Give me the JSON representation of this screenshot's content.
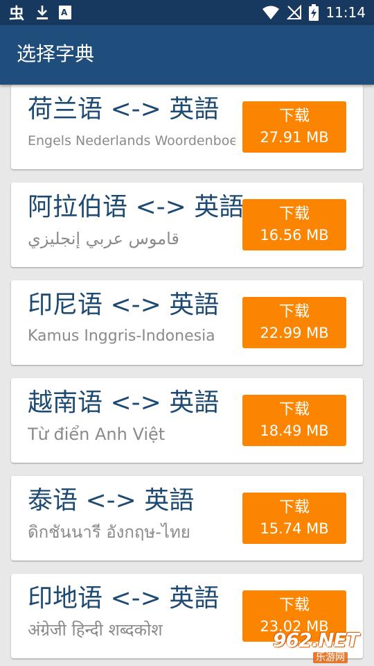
{
  "status_bar": {
    "time": "11:14",
    "left_icons": [
      "bug-icon",
      "download-icon",
      "font-icon"
    ],
    "right_icons": [
      "wifi-icon",
      "no-signal-icon",
      "battery-charging-icon"
    ]
  },
  "app_bar": {
    "title": "选择字典"
  },
  "colors": {
    "status_bar": "#17395f",
    "app_bar": "#1f4e7c",
    "title_text": "#1c4a73",
    "subtitle_text": "#8a8a8a",
    "button": "#fb8500",
    "background": "#e8e8e8"
  },
  "dictionaries": [
    {
      "title": "荷兰语 <-> 英語",
      "subtitle": "Engels Nederlands Woordenboek",
      "button_label": "下载",
      "size": "27.91 MB"
    },
    {
      "title": "阿拉伯语 <-> 英語",
      "subtitle": "قاموس عربي إنجليزي",
      "button_label": "下载",
      "size": "16.56 MB"
    },
    {
      "title": "印尼语 <-> 英語",
      "subtitle": "Kamus Inggris-Indonesia",
      "button_label": "下载",
      "size": "22.99 MB"
    },
    {
      "title": "越南语 <-> 英語",
      "subtitle": "Từ điển Anh Việt",
      "button_label": "下载",
      "size": "18.49 MB"
    },
    {
      "title": "泰语 <-> 英語",
      "subtitle": "ดิกชันนารี อังกฤษ-ไทย",
      "button_label": "下载",
      "size": "15.74 MB"
    },
    {
      "title": "印地语 <-> 英語",
      "subtitle": "अंग्रेजी हिन्दी शब्दकोश",
      "button_label": "下载",
      "size": "23.02 MB"
    }
  ],
  "watermark": {
    "logo": "962.NET",
    "caption": "乐游网"
  }
}
